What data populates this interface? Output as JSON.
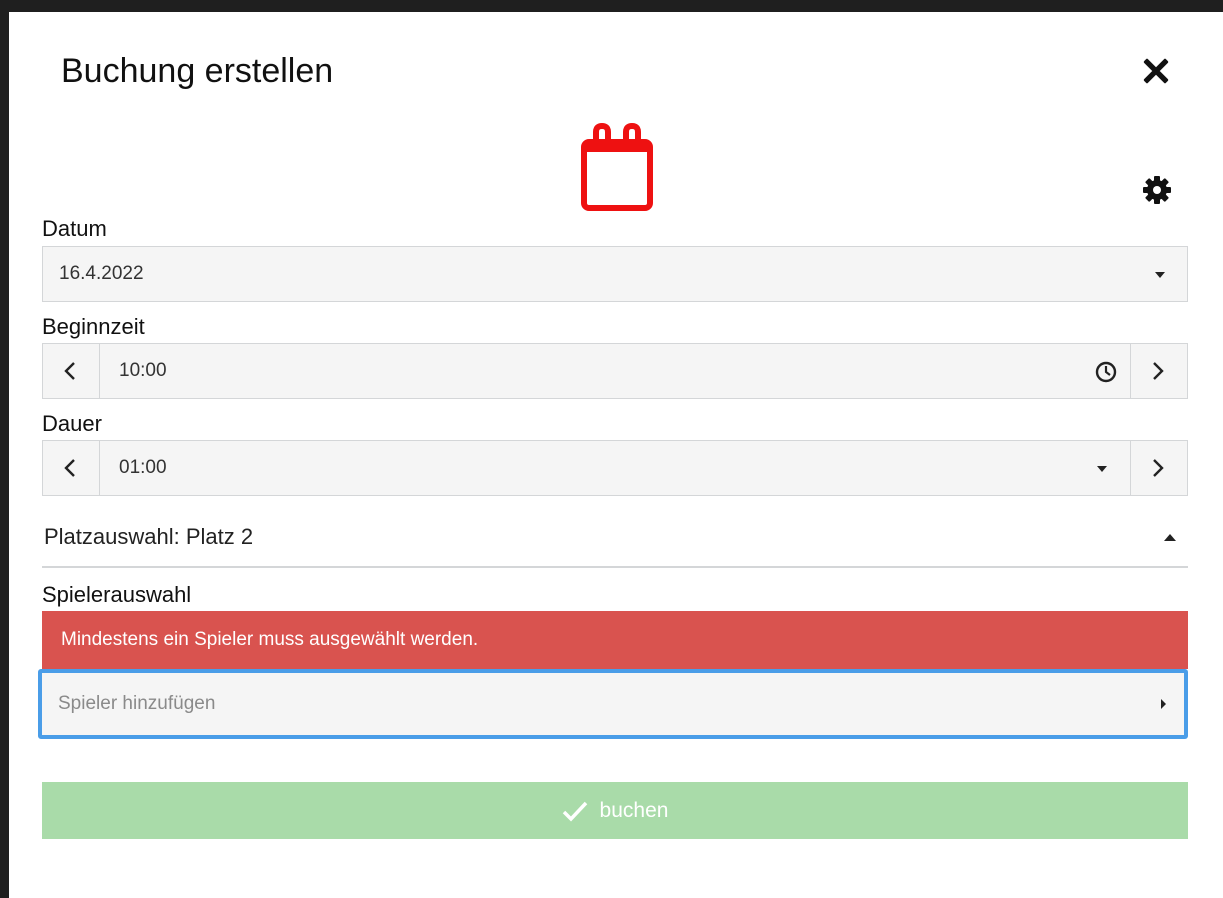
{
  "dialog": {
    "title": "Buchung erstellen",
    "close_icon": "close-icon",
    "calendar_icon": "calendar-icon",
    "settings_icon": "gear-icon",
    "accent_color": "#ee1111"
  },
  "datum": {
    "label": "Datum",
    "value": "16.4.2022"
  },
  "beginnzeit": {
    "label": "Beginnzeit",
    "value": "10:00",
    "icon": "clock-icon"
  },
  "dauer": {
    "label": "Dauer",
    "value": "01:00"
  },
  "platzauswahl": {
    "label": "Platzauswahl: Platz 2"
  },
  "spielerauswahl": {
    "label": "Spielerauswahl",
    "error": "Mindestens ein Spieler muss ausgewählt werden.",
    "error_color": "#d9534f",
    "placeholder": "Spieler hinzufügen",
    "focus_color": "#4a9de8"
  },
  "submit": {
    "label": "buchen",
    "color": "#a9dba9",
    "icon": "check-icon"
  }
}
